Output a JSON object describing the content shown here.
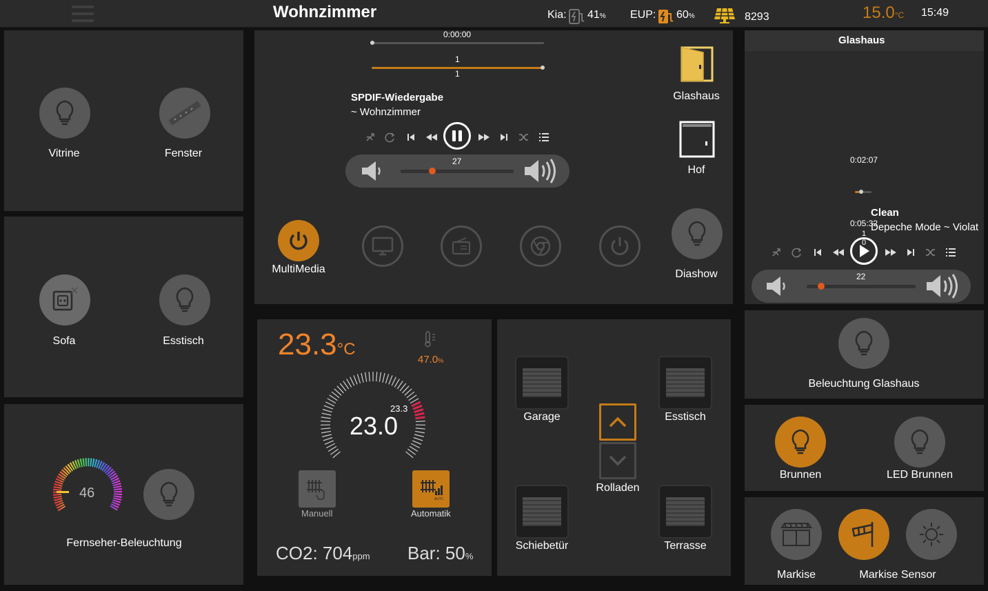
{
  "topbar": {
    "title": "Wohnzimmer",
    "kia_label": "Kia:",
    "kia_value": "41",
    "kia_unit": "%",
    "eup_label": "EUP:",
    "eup_value": "60",
    "eup_unit": "%",
    "solar_value": "8293",
    "outside_temp": "15.0",
    "outside_temp_unit": "°C",
    "time": "15:49"
  },
  "lights_top": {
    "vitrine": "Vitrine",
    "fenster": "Fenster"
  },
  "lights_mid": {
    "sofa": "Sofa",
    "esstisch": "Esstisch"
  },
  "tv_light": {
    "value": "46",
    "label": "Fernseher-Beleuchtung"
  },
  "media": {
    "time": "0:00:00",
    "track_num_top": "1",
    "track_num_bottom": "1",
    "source": "SPDIF-Wiedergabe",
    "room": "~ Wohnzimmer",
    "volume": "27",
    "volume_fraction": 0.3,
    "buttons": {
      "multimedia": "MultiMedia",
      "diashow": "Diashow"
    },
    "doors": {
      "glashaus": "Glashaus",
      "hof": "Hof"
    }
  },
  "glashaus_player": {
    "title": "Glashaus",
    "elapsed": "0:02:07",
    "duration": "0:05:32",
    "track_num": "1",
    "track_num2": "0",
    "song": "Clean",
    "artist": "Depeche Mode ~ Violat",
    "volume": "22",
    "volume_fraction": 0.13
  },
  "climate": {
    "current_temp": "23.3",
    "temp_unit": "°C",
    "humidity": "47.0",
    "humidity_unit": "%",
    "setpoint": "23.0",
    "gauge_marker": "23.3",
    "mode_manual": "Manuell",
    "mode_auto": "Automatik",
    "co2_label": "CO2: 704",
    "co2_unit": "ppm",
    "bar_label": "Bar: 50",
    "bar_unit": "%"
  },
  "shutters": {
    "garage": "Garage",
    "esstisch": "Esstisch",
    "rolladen": "Rolladen",
    "schiebetuer": "Schiebetür",
    "terrasse": "Terrasse"
  },
  "glashaus_light": {
    "label": "Beleuchtung Glashaus"
  },
  "brunnen": {
    "brunnen": "Brunnen",
    "led_brunnen": "LED Brunnen"
  },
  "markise": {
    "markise": "Markise",
    "sensor": "Markise Sensor"
  },
  "colors": {
    "accent": "#c67b17",
    "temp": "#f0832a",
    "panel": "#2b2b2b",
    "gauge_red": "#d9264f"
  }
}
